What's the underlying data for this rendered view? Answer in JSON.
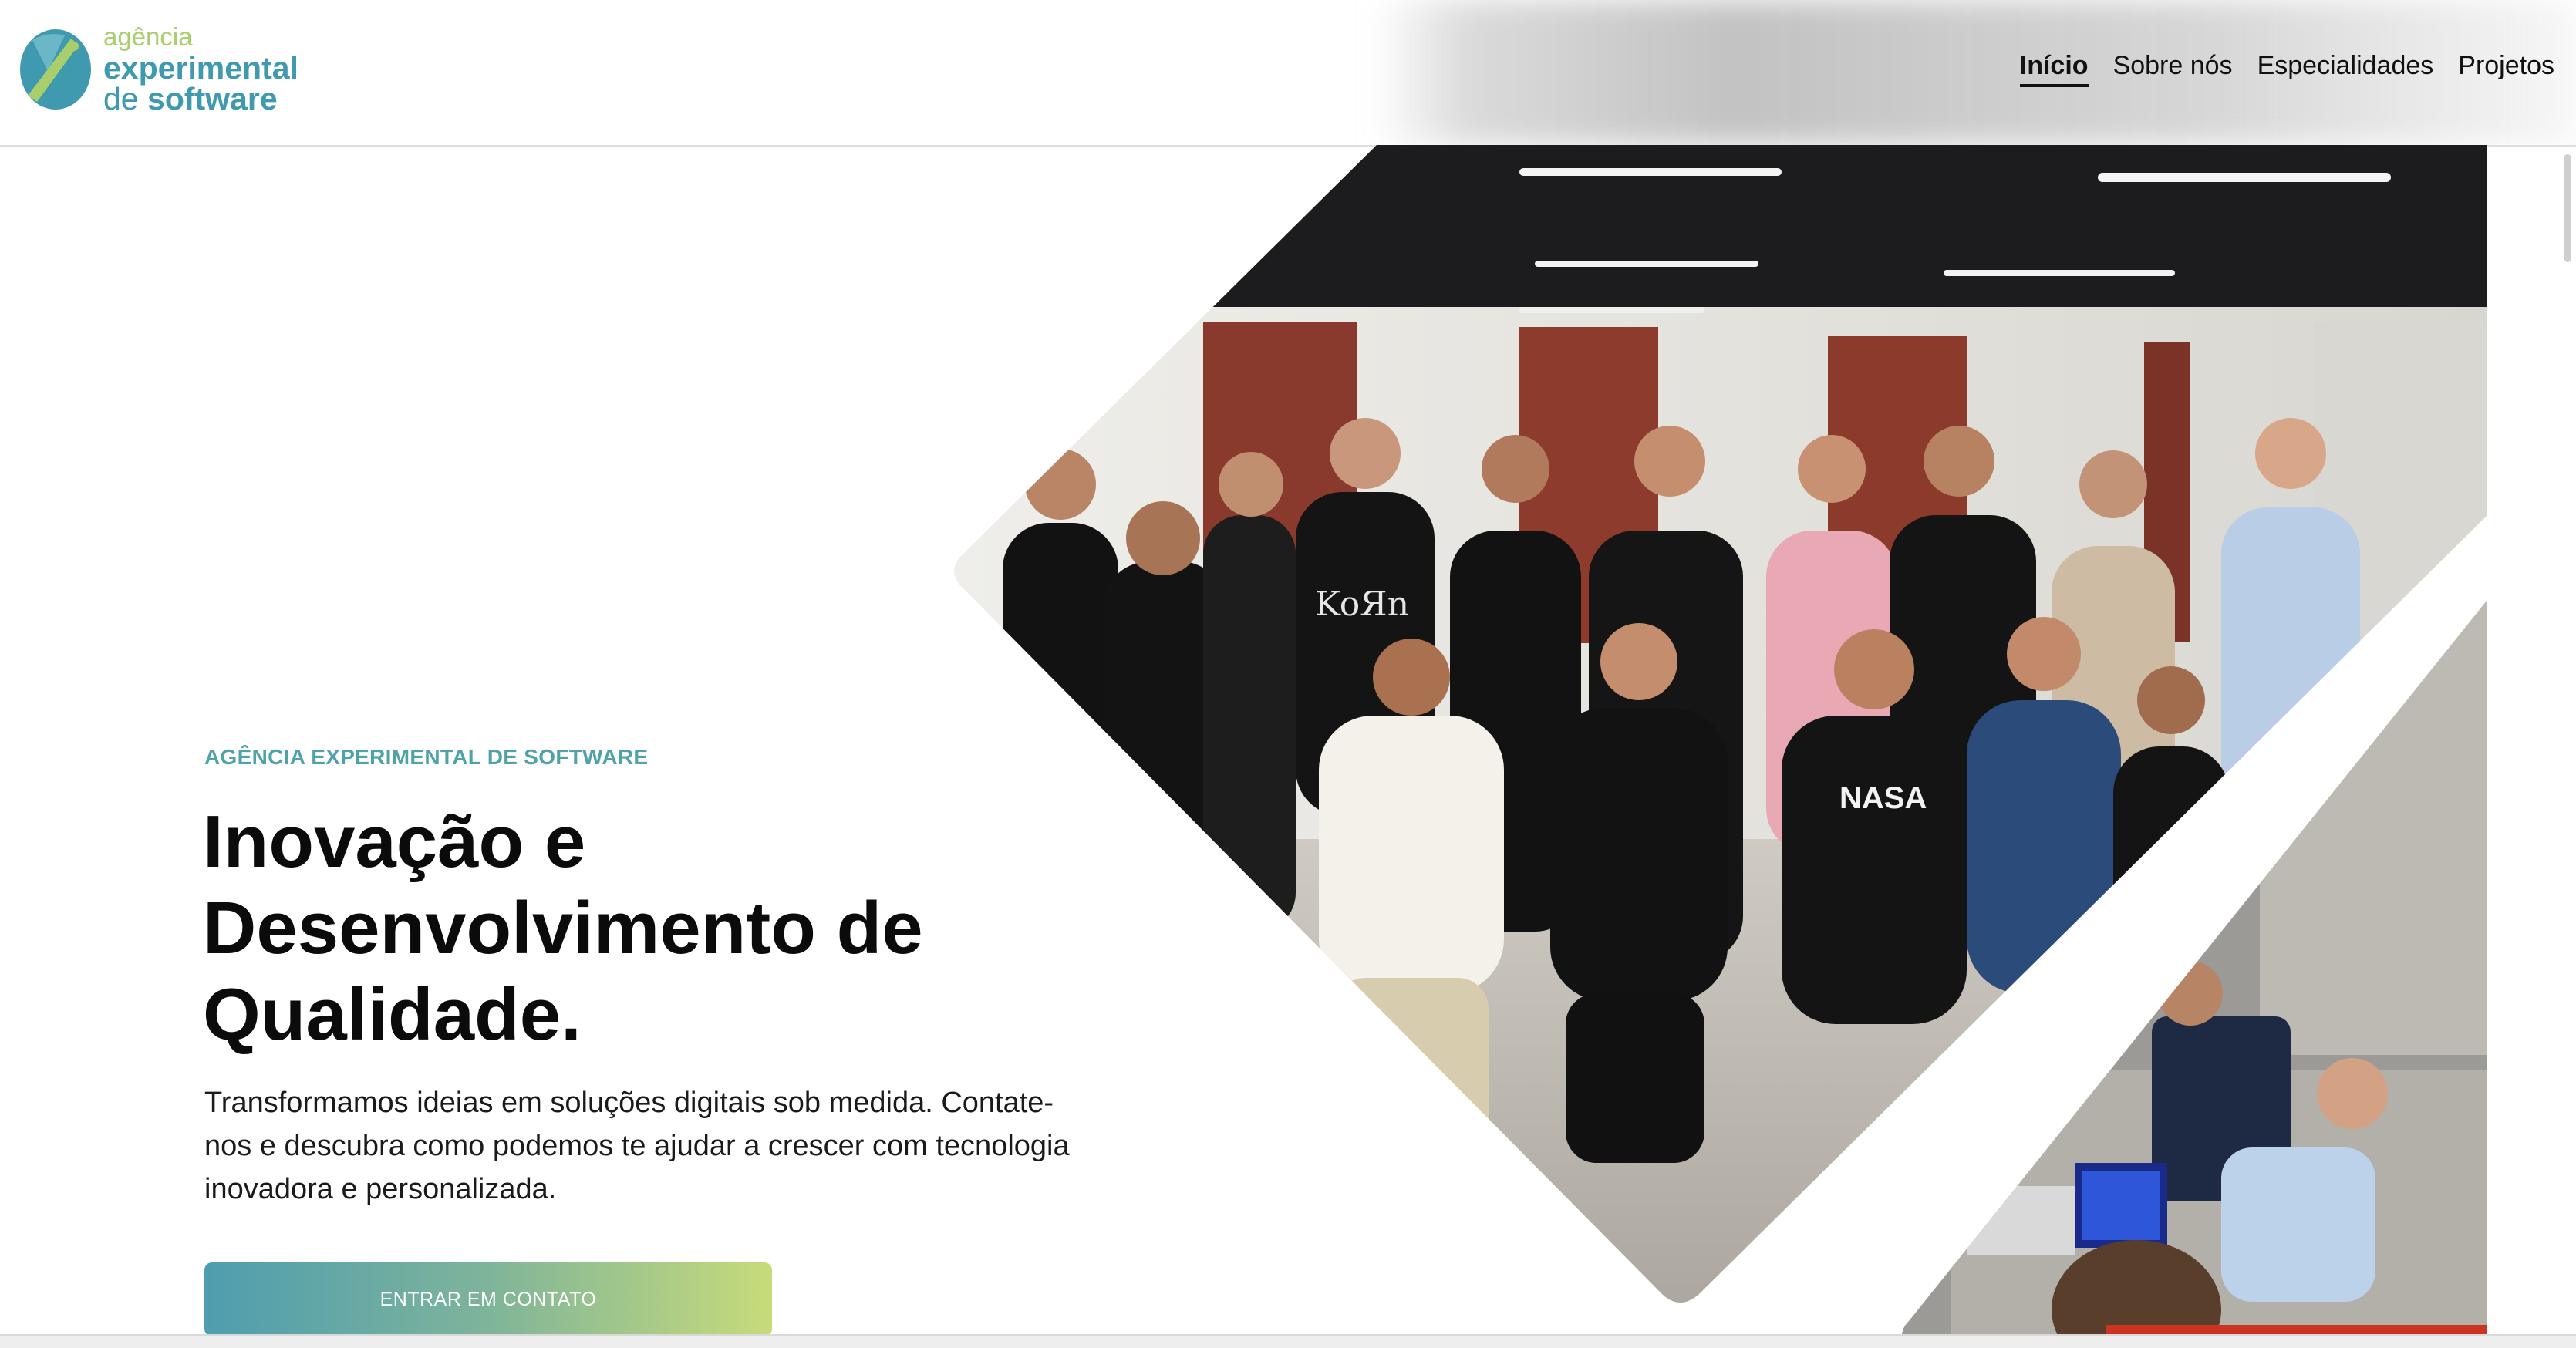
{
  "brand": {
    "line1": "agência",
    "line2": "experimental",
    "line3_a": "de",
    "line3_b": "software",
    "primary_color": "#3f9ab0",
    "accent_color": "#a8cf6b"
  },
  "nav": {
    "items": [
      {
        "label": "Início",
        "active": true
      },
      {
        "label": "Sobre nós",
        "active": false
      },
      {
        "label": "Especialidades",
        "active": false
      },
      {
        "label": "Projetos",
        "active": false
      }
    ]
  },
  "hero": {
    "eyebrow": "AGÊNCIA EXPERIMENTAL DE SOFTWARE",
    "title": "Inovação e Desenvolvimento de Qualidade.",
    "subtitle": "Transformamos ideias em soluções digitais sob medida. Contate-nos e descubra como podemos te ajudar a crescer com tecnologia inovadora e personalizada.",
    "cta_label": "ENTRAR EM CONTATO",
    "cta_gradient": [
      "#4e9db0",
      "#c7db7a"
    ]
  },
  "images": {
    "team_photo": "team-group-photo",
    "work_photo": "team-working-photo",
    "shirt_text_1": "KoЯn",
    "shirt_text_2": "NASA"
  }
}
